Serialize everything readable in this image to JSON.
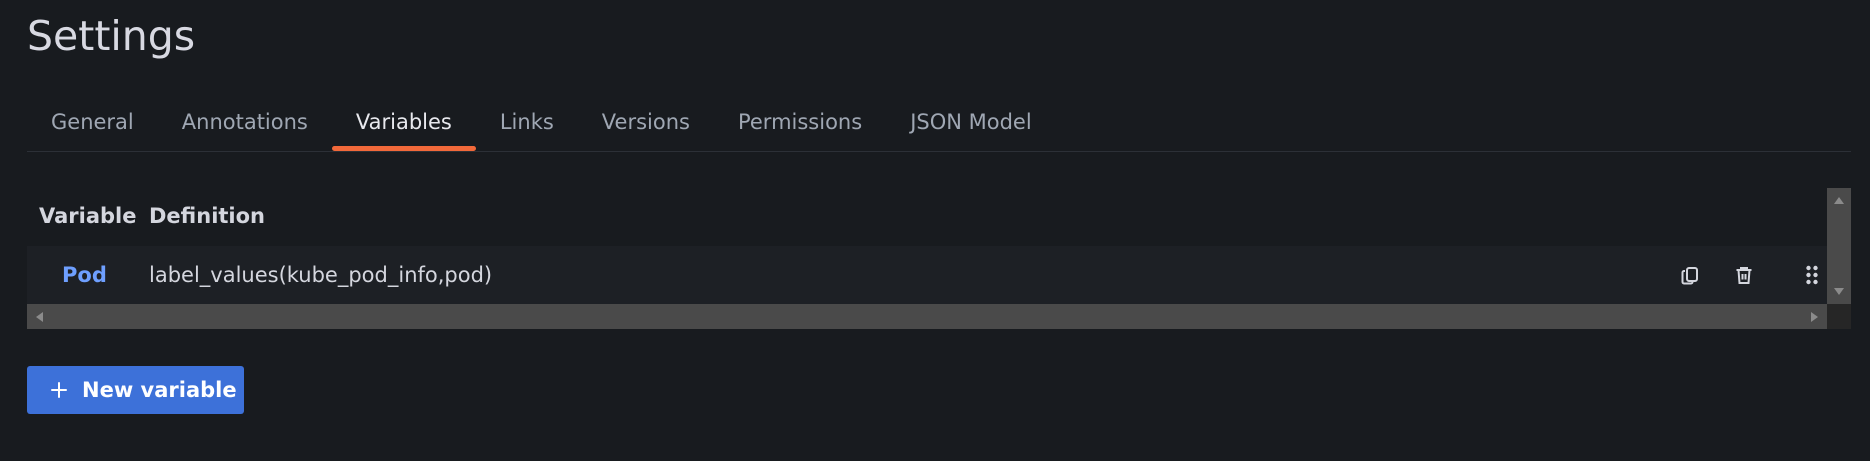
{
  "page": {
    "title": "Settings"
  },
  "tabs": [
    {
      "label": "General",
      "active": false
    },
    {
      "label": "Annotations",
      "active": false
    },
    {
      "label": "Variables",
      "active": true
    },
    {
      "label": "Links",
      "active": false
    },
    {
      "label": "Versions",
      "active": false
    },
    {
      "label": "Permissions",
      "active": false
    },
    {
      "label": "JSON Model",
      "active": false
    }
  ],
  "variables_table": {
    "columns": [
      "Variable",
      "Definition"
    ],
    "rows": [
      {
        "variable": "Pod",
        "definition": "label_values(kube_pod_info,pod)",
        "actions": [
          "duplicate-icon",
          "trash-icon",
          "drag-handle-icon"
        ]
      }
    ]
  },
  "new_variable_button": {
    "label": "New variable",
    "icon": "plus-icon"
  },
  "colors": {
    "background": "#181b1f",
    "active_tab_underline": "#f2693a",
    "link": "#6e9fff",
    "primary_button": "#3d71d9"
  }
}
